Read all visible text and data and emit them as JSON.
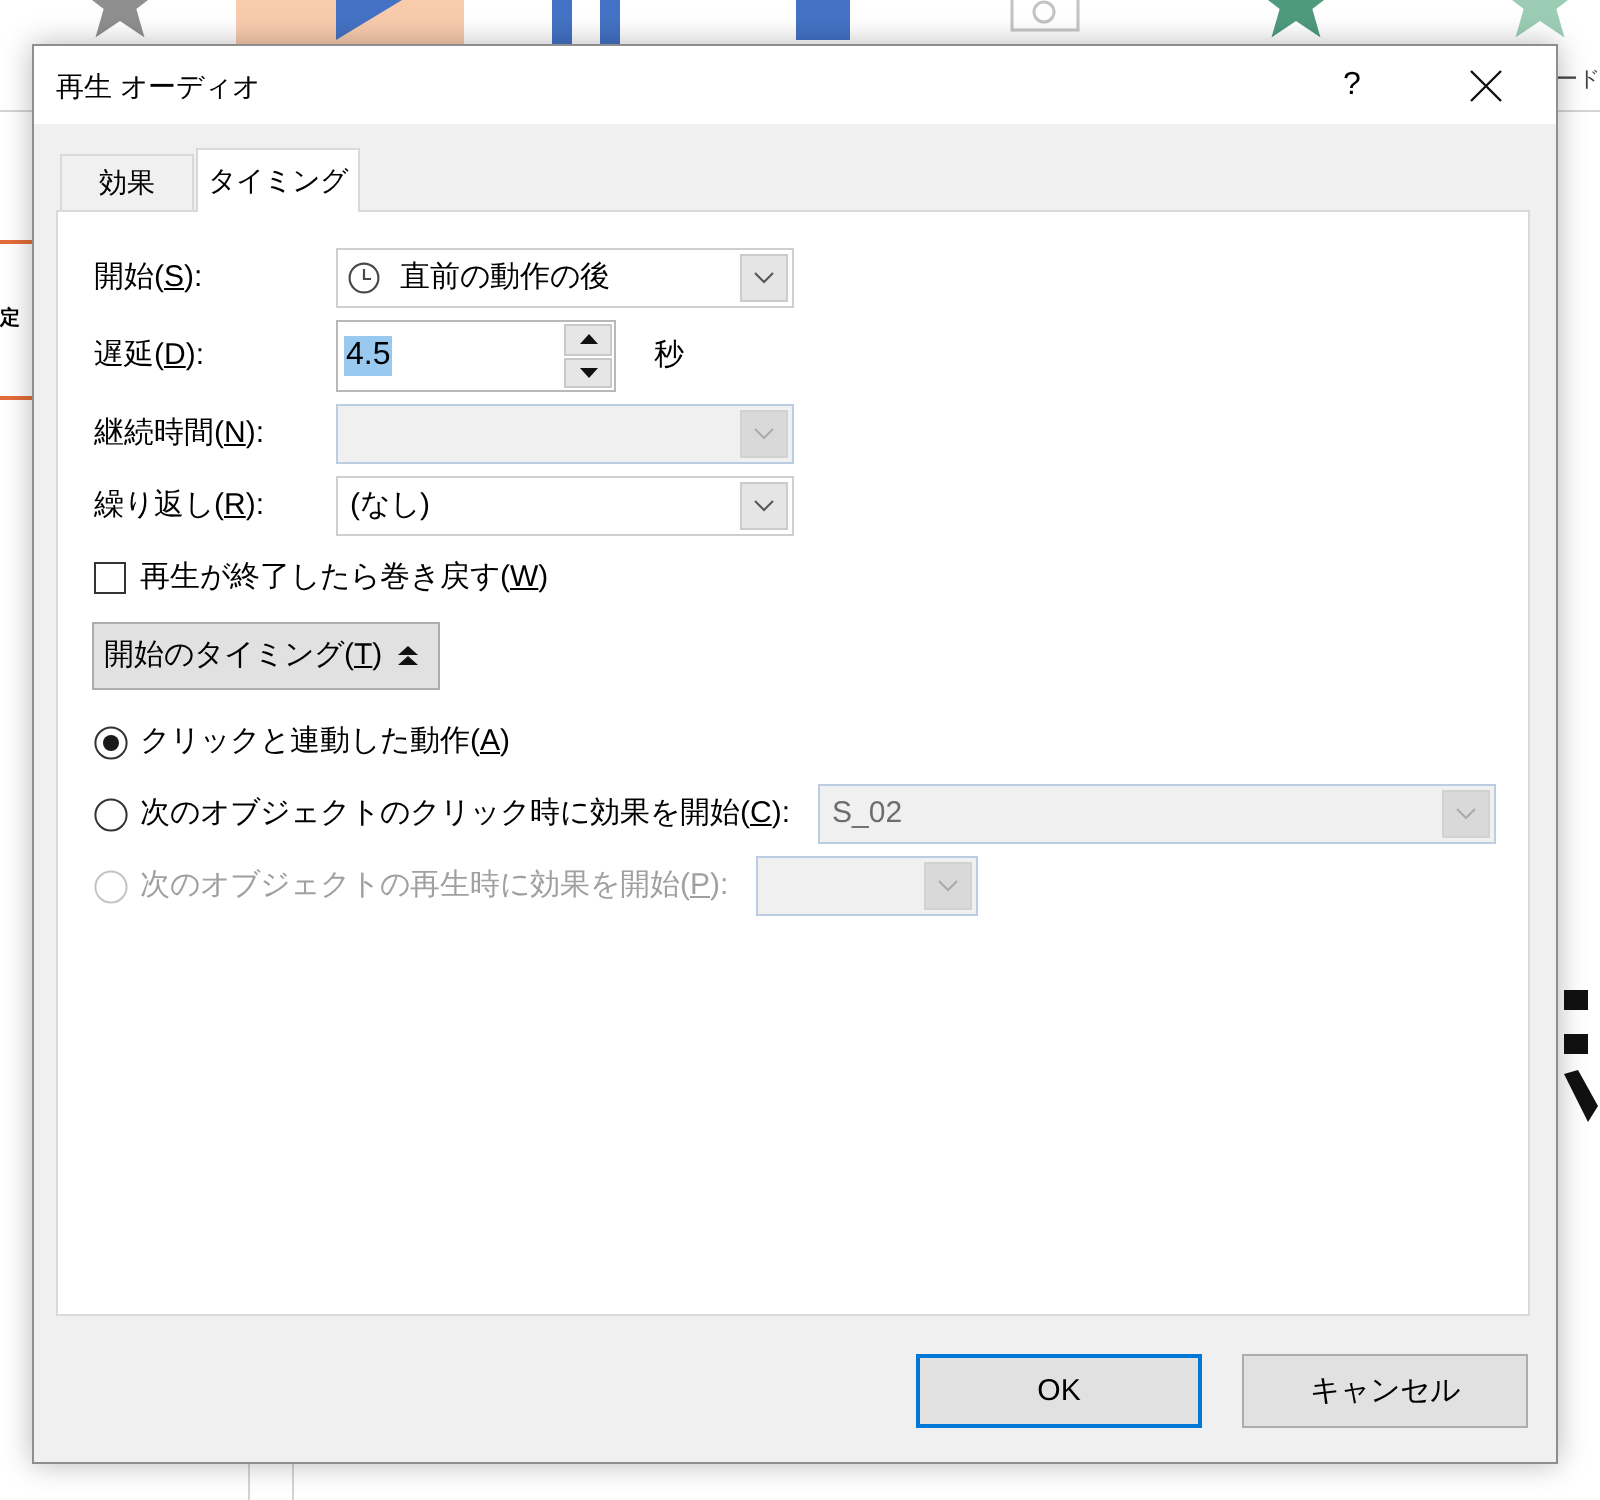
{
  "background": {
    "ribbon_label": "ード",
    "thumbnail_label": "定"
  },
  "window": {
    "title": "再生 オーディオ",
    "help": "?"
  },
  "tabs": [
    {
      "label": "効果",
      "selected": false
    },
    {
      "label": "タイミング",
      "selected": true
    }
  ],
  "fields": [
    {
      "kind": "timing",
      "label_start": "開始(",
      "access_key": "S",
      "label_end": "):",
      "value": "直前の動作の後",
      "disabled": false
    },
    {
      "kind": "spinner",
      "label_start": "遅延(",
      "access_key": "D",
      "label_end": "):",
      "value": "4.5",
      "value_selected": true,
      "unit": "秒",
      "disabled": false
    },
    {
      "kind": "select",
      "label_start": "継続時間(",
      "access_key": "N",
      "label_end": "):",
      "disabled": true
    },
    {
      "kind": "select",
      "label_start": "繰り返し(",
      "access_key": "R",
      "label_end": "):",
      "value": "(なし)",
      "disabled": false
    }
  ],
  "rewind": {
    "label_start": "再生が終了したら巻き戻す(",
    "access_key": "W",
    "label_end": ")",
    "checked": false
  },
  "triggers_button": {
    "label_start": "開始のタイミング(",
    "access_key": "T",
    "label_end": ")",
    "expanded": true
  },
  "triggers": [
    {
      "label_start": "クリックと連動した動作(",
      "access_key": "A",
      "label_end": ")",
      "selected": true,
      "disabled": false
    },
    {
      "label_start": "次のオブジェクトのクリック時に効果を開始(",
      "access_key": "C",
      "label_end": "):",
      "selected": false,
      "disabled": false,
      "combo": {
        "value": "S_02",
        "disabled": true
      }
    },
    {
      "label_start": "次のオブジェクトの再生時に効果を開始(",
      "access_key": "P",
      "label_end": "):",
      "selected": false,
      "disabled": true,
      "combo": {
        "disabled": true
      }
    }
  ],
  "buttons": [
    {
      "label": "OK",
      "default": true
    },
    {
      "label": "キャンセル",
      "default": false
    }
  ]
}
